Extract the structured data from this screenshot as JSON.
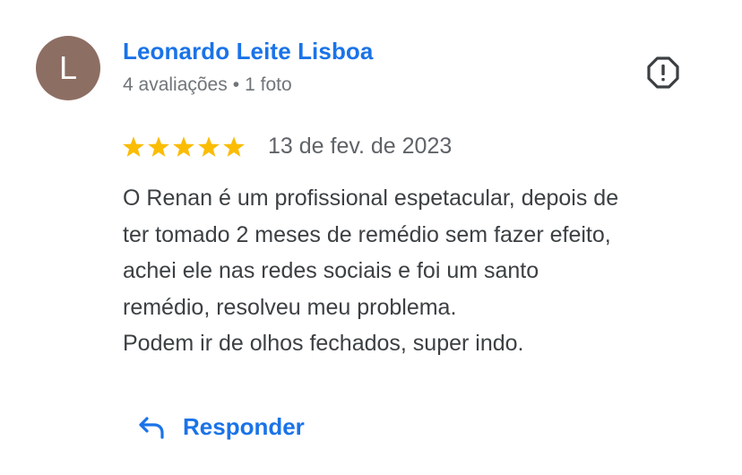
{
  "review": {
    "avatar_letter": "L",
    "avatar_color": "#8d6e63",
    "author_name": "Leonardo Leite Lisboa",
    "reviews_count": "4 avaliações",
    "separator": "•",
    "photos_count": "1 foto",
    "rating": 5,
    "rating_max": 5,
    "star_color": "#fbbc04",
    "date": "13 de fev. de 2023",
    "text_lines": [
      "O Renan é um profissional espetacular, depois de",
      "ter tomado 2 meses de remédio sem fazer efeito,",
      "achei ele nas redes sociais e foi um santo",
      "remédio, resolveu meu problema.",
      "Podem ir de olhos fechados, super indo."
    ],
    "flag_icon": "report-icon",
    "reply_icon": "reply-arrow-icon",
    "reply_label": "Responder",
    "accent_color": "#1a73e8"
  }
}
